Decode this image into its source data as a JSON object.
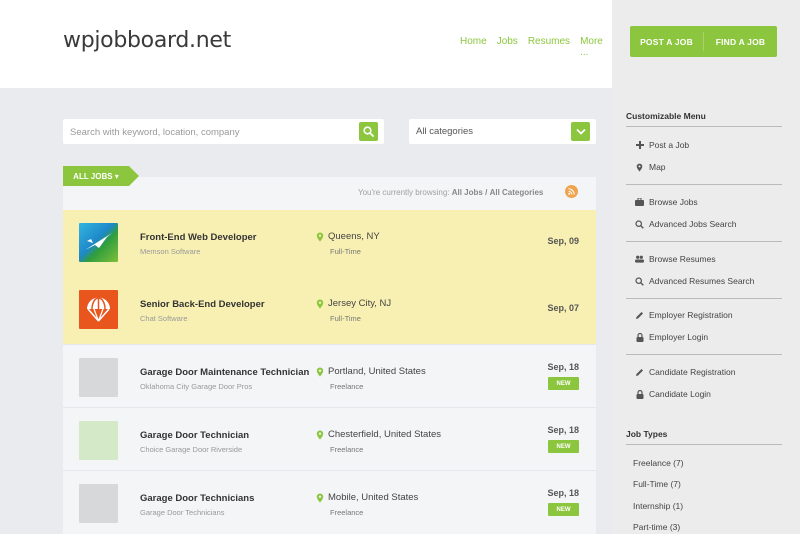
{
  "header": {
    "logo": "wpjobboard.net",
    "nav": [
      "Home",
      "Jobs",
      "Resumes",
      "More ..."
    ],
    "cta": {
      "post": "POST A JOB",
      "find": "FIND A JOB"
    }
  },
  "search": {
    "placeholder": "Search with keyword, location, company",
    "category": "All categories"
  },
  "list": {
    "tab_label": "ALL JOBS ▾",
    "browsing_prefix": "You're currently browsing:",
    "browsing_jobs": "All Jobs",
    "browsing_sep": "/",
    "browsing_cat": "All Categories"
  },
  "jobs": [
    {
      "title": "Front-End Web Developer",
      "company": "Memson Software",
      "location": "Queens, NY",
      "type": "Full-Time",
      "date": "Sep, 09",
      "featured": true,
      "badge": "",
      "logo": "plane-logo-icon"
    },
    {
      "title": "Senior Back-End Developer",
      "company": "Chat Software",
      "location": "Jersey City, NJ",
      "type": "Full-Time",
      "date": "Sep, 07",
      "featured": true,
      "badge": "",
      "logo": "parachute-logo-icon"
    },
    {
      "title": "Garage Door Maintenance Technician",
      "company": "Oklahoma City Garage Door Pros",
      "location": "Portland, United States",
      "type": "Freelance",
      "date": "Sep, 18",
      "featured": false,
      "badge": "NEW",
      "logo": "placeholder-logo-icon"
    },
    {
      "title": "Garage Door Technician",
      "company": "Choice Garage Door Riverside",
      "location": "Chesterfield, United States",
      "type": "Freelance",
      "date": "Sep, 18",
      "featured": false,
      "badge": "NEW",
      "logo": "placeholder-logo-icon"
    },
    {
      "title": "Garage Door Technicians",
      "company": "Garage Door Technicians",
      "location": "Mobile, United States",
      "type": "Freelance",
      "date": "Sep, 18",
      "featured": false,
      "badge": "NEW",
      "logo": "placeholder-logo-icon"
    }
  ],
  "sidebar": {
    "menu_title": "Customizable Menu",
    "items": [
      {
        "label": "Post a Job",
        "icon": "plus-icon"
      },
      {
        "label": "Map",
        "icon": "map-pin-icon"
      },
      {
        "label": "Browse Jobs",
        "icon": "briefcase-icon"
      },
      {
        "label": "Advanced Jobs Search",
        "icon": "search-icon"
      },
      {
        "label": "Browse Resumes",
        "icon": "users-icon"
      },
      {
        "label": "Advanced Resumes Search",
        "icon": "search-icon"
      },
      {
        "label": "Employer Registration",
        "icon": "pencil-icon"
      },
      {
        "label": "Employer Login",
        "icon": "lock-icon"
      },
      {
        "label": "Candidate Registration",
        "icon": "pencil-icon"
      },
      {
        "label": "Candidate Login",
        "icon": "lock-icon"
      }
    ],
    "job_types_title": "Job Types",
    "job_types": [
      "Freelance (7)",
      "Full-Time (7)",
      "Internship (1)",
      "Part-time (3)"
    ]
  },
  "colors": {
    "accent": "#8cc63e",
    "featured": "#f8f0b2",
    "rss": "#f0a34e"
  }
}
